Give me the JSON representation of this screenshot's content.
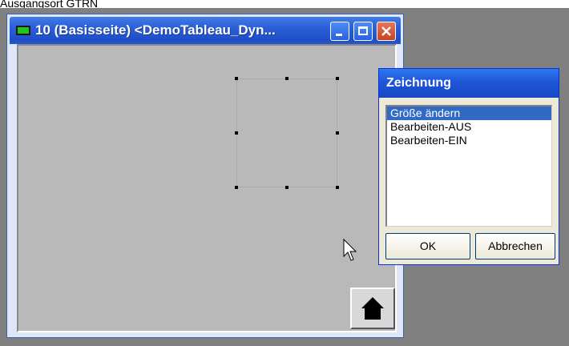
{
  "caption": "Ausgangsort GTRN",
  "main_window": {
    "title": "10 (Basisseite) <DemoTableau_Dyn...",
    "buttons": {
      "minimize": "minimize",
      "maximize": "maximize",
      "close": "close"
    }
  },
  "dialog": {
    "title": "Zeichnung",
    "items": [
      {
        "label": "Größe ändern",
        "selected": true
      },
      {
        "label": "Bearbeiten-AUS",
        "selected": false
      },
      {
        "label": "Bearbeiten-EIN",
        "selected": false
      }
    ],
    "ok_label": "OK",
    "cancel_label": "Abbrechen"
  },
  "colors": {
    "title_bar": "#2b5fd6",
    "client_bg": "#b9b9b9",
    "selection_highlight": "#316ac5"
  }
}
